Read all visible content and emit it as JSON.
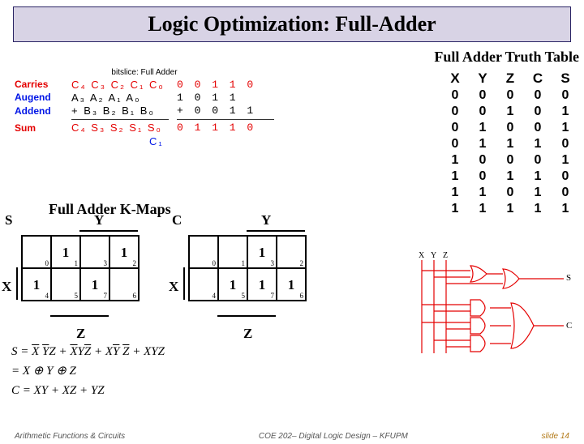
{
  "title": "Logic Optimization: Full-Adder",
  "truth_table_heading": "Full Adder Truth Table",
  "kmap_heading": "Full Adder K-Maps",
  "addition": {
    "bitslice_label": "bitslice: Full Adder",
    "labels": {
      "carries": "Carries",
      "augend": "Augend",
      "addend": "Addend",
      "sum": "Sum"
    },
    "carry_syms": "C₄ C₃ C₂ C₁ C₀",
    "augend_syms": "A₃ A₂ A₁ A₀",
    "addend_syms": "+ B₃ B₂ B₁ B₀",
    "sum_syms": "C₄ S₃ S₂ S₁ S₀",
    "c4_extra": "C₁",
    "carry_bits": "0 0 1 1 0",
    "augend_bits": "1 0 1 1",
    "addend_bits": "+ 0 0 1 1",
    "sum_bits": "0 1 1 1 0"
  },
  "truth_table": {
    "headers": [
      "X",
      "Y",
      "Z",
      "C",
      "S"
    ],
    "rows": [
      [
        "0",
        "0",
        "0",
        "0",
        "0"
      ],
      [
        "0",
        "0",
        "1",
        "0",
        "1"
      ],
      [
        "0",
        "1",
        "0",
        "0",
        "1"
      ],
      [
        "0",
        "1",
        "1",
        "1",
        "0"
      ],
      [
        "1",
        "0",
        "0",
        "0",
        "1"
      ],
      [
        "1",
        "0",
        "1",
        "1",
        "0"
      ],
      [
        "1",
        "1",
        "0",
        "1",
        "0"
      ],
      [
        "1",
        "1",
        "1",
        "1",
        "1"
      ]
    ]
  },
  "kmaps": {
    "labels": {
      "x": "X",
      "y": "Y",
      "z": "Z"
    },
    "s": {
      "name": "S",
      "cells": [
        {
          "idx": "0",
          "val": ""
        },
        {
          "idx": "1",
          "val": "1"
        },
        {
          "idx": "3",
          "val": ""
        },
        {
          "idx": "2",
          "val": "1"
        },
        {
          "idx": "4",
          "val": "1"
        },
        {
          "idx": "5",
          "val": ""
        },
        {
          "idx": "7",
          "val": "1"
        },
        {
          "idx": "6",
          "val": ""
        }
      ]
    },
    "c": {
      "name": "C",
      "cells": [
        {
          "idx": "0",
          "val": ""
        },
        {
          "idx": "1",
          "val": ""
        },
        {
          "idx": "3",
          "val": "1"
        },
        {
          "idx": "2",
          "val": ""
        },
        {
          "idx": "4",
          "val": ""
        },
        {
          "idx": "5",
          "val": "1"
        },
        {
          "idx": "7",
          "val": "1"
        },
        {
          "idx": "6",
          "val": "1"
        }
      ]
    }
  },
  "equations": {
    "s_sop": "S = X̄ȲZ + X̄YZ̄ + XȲZ̄ + XYZ",
    "s_xor": "= X ⊕ Y ⊕ Z",
    "c": "C = XY + XZ + YZ"
  },
  "circuit_labels": {
    "x": "X",
    "y": "Y",
    "z": "Z",
    "s": "S",
    "c": "C"
  },
  "footer": {
    "left": "Arithmetic Functions & Circuits",
    "center": "COE 202– Digital Logic Design – KFUPM",
    "right": "slide 14"
  }
}
